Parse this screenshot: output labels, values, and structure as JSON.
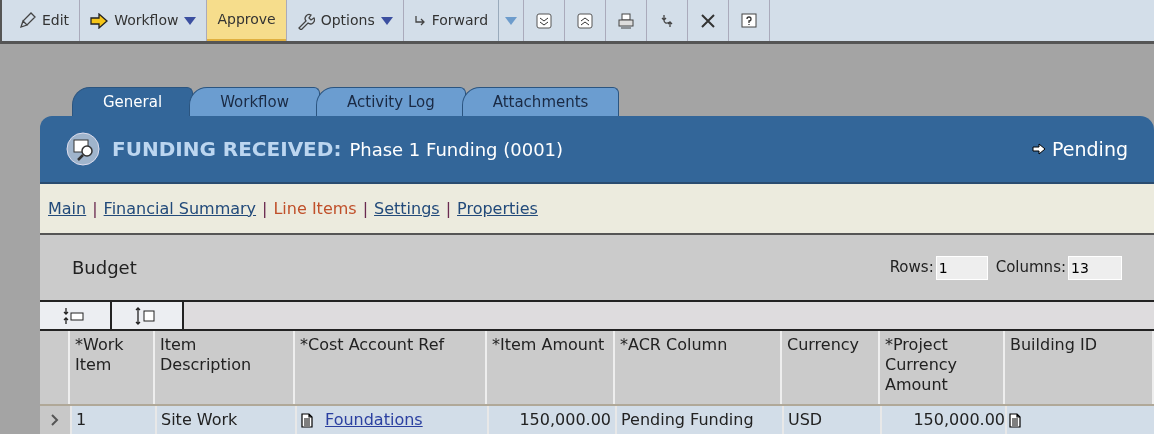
{
  "toolbar": [
    {
      "label": "Edit",
      "kind": "button",
      "highlighted": false
    },
    {
      "label": "Workflow",
      "kind": "menu",
      "highlighted": false
    },
    {
      "label": "Approve",
      "kind": "button",
      "highlighted": true
    },
    {
      "label": "Options",
      "kind": "menu",
      "highlighted": false
    },
    {
      "label": "Forward",
      "kind": "split",
      "highlighted": false
    }
  ],
  "tabs": [
    {
      "label": "General",
      "selected": true
    },
    {
      "label": "Workflow",
      "selected": false
    },
    {
      "label": "Activity Log",
      "selected": false
    },
    {
      "label": "Attachments",
      "selected": false
    }
  ],
  "header": {
    "type": "FUNDING RECEIVED:",
    "title": "Phase 1 Funding",
    "number": "(0001)",
    "status": "Pending"
  },
  "nav_separator": "|",
  "nav": [
    {
      "label": "Main",
      "selected": false
    },
    {
      "label": "Financial Summary",
      "selected": false
    },
    {
      "label": "Line Items",
      "selected": true
    },
    {
      "label": "Settings",
      "selected": false
    },
    {
      "label": "Properties",
      "selected": false
    }
  ],
  "budget": {
    "title": "Budget",
    "rows_label": "Rows:",
    "rows": "1",
    "columns_label": "Columns:",
    "columns": "13"
  },
  "table": {
    "columns": [
      "*Work Item",
      "Item Description",
      "*Cost Account Ref",
      "*Item Amount",
      "*ACR Column",
      "Currency",
      "*Project Currency Amount",
      "Building ID"
    ],
    "rows": [
      {
        "selected": true,
        "cells": [
          "1",
          "Site Work",
          "Foundations",
          "150,000.00",
          "Pending Funding",
          "USD",
          "150,000.00",
          ""
        ]
      }
    ]
  }
}
